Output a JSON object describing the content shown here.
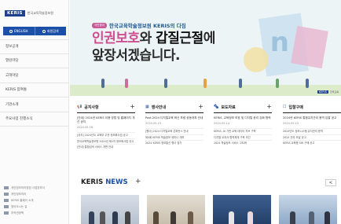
{
  "sidebar": {
    "logo": "KERIS",
    "logo_sub": "한국교육학술정보원",
    "tabs": [
      {
        "label": "ENGLISH"
      },
      {
        "label": "회원검색"
      }
    ],
    "menu": [
      {
        "label": "정보공개"
      },
      {
        "label": "열린마당"
      },
      {
        "label": "고객마당"
      },
      {
        "label": "KERIS 참여통"
      },
      {
        "label": "기관소개"
      },
      {
        "label": "주요사업 진행소식"
      }
    ],
    "links": [
      {
        "label": "개인정보처리방침 사업장부서"
      },
      {
        "label": "개인정보처리"
      },
      {
        "label": "KERIS 홈페이 소개"
      },
      {
        "label": "찾아오시는 길"
      },
      {
        "label": "저작권정책"
      },
      {
        "label": "이메일무단"
      }
    ]
  },
  "hero": {
    "badge": "국민참여",
    "badge_text": "한국교육학술정보원 KERIS의 다짐",
    "title_line1_a": "인권보호",
    "title_line1_b": "와 ",
    "title_line1_c": "갑질근절",
    "title_line1_d": "에",
    "title_line2": "앞장서겠습니다.",
    "letter": "n",
    "mini_logo": "KERIS",
    "mini_sub": "한국교육"
  },
  "boards": [
    {
      "icon": "📢",
      "title": "공지사항",
      "post": "[안내] 2024년 KERIS 이용 방법 및 홈페이지 개선 공지",
      "date": "2024.05.16",
      "subs": [
        "[공지] 2024년도 교육부 주관 정보화사업 공고",
        "한국교육학술정보원 2024년 제2차 정보화사업 공고",
        "[안내] 통합검색 서비스 개편 안내"
      ]
    },
    {
      "icon": "▦",
      "title": "행사안내",
      "post": "Post-2024 디지털교육 혁신 포럼 공동개최 안내",
      "date": "2024.05.15",
      "subs": [
        "[행사] 2024 디지털교육 콘퍼런스 안내",
        "제4회 KERIS 학술정보 세미나 개최",
        "2024 KERIS 정보통신 행사 참가"
      ]
    },
    {
      "icon": "🗞",
      "title": "보도자료",
      "post": "KERIS, 교육정보 보호 및 디지털 윤리 강화 협력",
      "date": "2024.05.14",
      "subs": [
        "KERIS, AI 기반 교육 데이터 허브 구축",
        "디지털 교과서 협력체계 구축 추진",
        "2024 학술정보 서비스 고도화"
      ]
    },
    {
      "icon": "☐",
      "title": "입찰구매",
      "post": "2024년 KERIS 통합유지관리 용역 입찰 공고",
      "date": "2024.05.13",
      "subs": [
        "2024년도 정보시스템 유지관리 용역",
        "2024 전자 조달 공고",
        "KERIS 교육용 SW 구매 공고"
      ]
    }
  ],
  "news": {
    "title_a": "KERIS ",
    "title_b": "NEWS",
    "plus": "+",
    "nav": "<"
  }
}
